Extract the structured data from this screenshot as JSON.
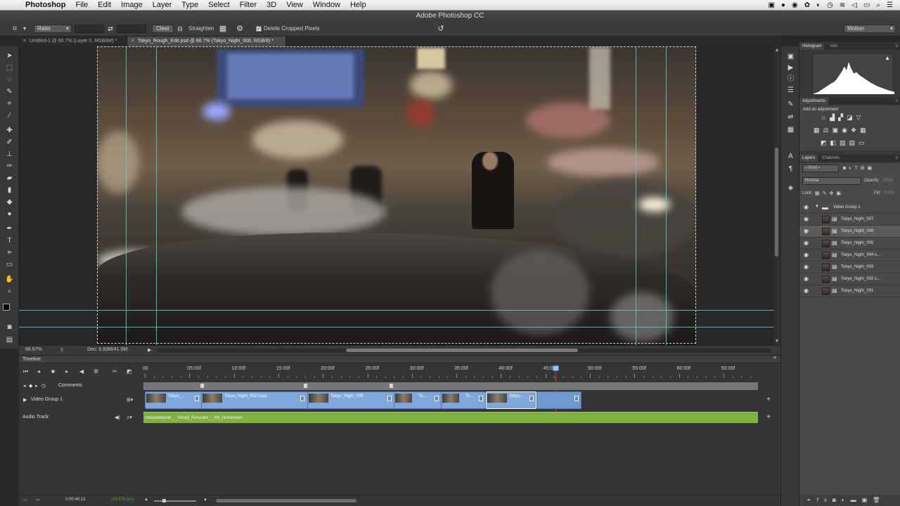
{
  "menubar": {
    "app": "Photoshop",
    "menus": [
      "File",
      "Edit",
      "Image",
      "Layer",
      "Type",
      "Select",
      "Filter",
      "3D",
      "View",
      "Window",
      "Help"
    ]
  },
  "window": {
    "title": "Adobe Photoshop CC"
  },
  "options": {
    "ratio": "Ratio",
    "clear": "Clear",
    "straighten": "Straighten",
    "delete_cropped": "Delete Cropped Pixels",
    "workspace": "Motion"
  },
  "tabs": [
    {
      "label": "Untitled-1 @ 66.7% (Layer 0, RGB/8#) *",
      "active": false
    },
    {
      "label": "Tokyo_Rough_Edit.psd @ 66.7% (Tokyo_Night_006, RGB/8) *",
      "active": true
    }
  ],
  "status": {
    "zoom": "66.67%",
    "doc": "Doc: 5.93M/41.5M"
  },
  "timeline": {
    "title": "Timeline",
    "ruler": [
      "00",
      "05:00f",
      "10:00f",
      "15:00f",
      "20:00f",
      "25:00f",
      "30:00f",
      "35:00f",
      "40:00f",
      "45:00f",
      "50:00f",
      "55:00f",
      "60:00f",
      "65:00f"
    ],
    "comments_label": "Comments",
    "video_group": "Video Group 1",
    "audio_label": "Audio Track",
    "audio_clip": "robwalkerpoet_-_Himeji_Furusato_-_My_Hometown",
    "clips": [
      "Tokyo_...",
      "Tokyo_Night_002 copy",
      "Tokyo_Night_003",
      "To...",
      "To...",
      "Tokyo..."
    ],
    "time": "0:00:46:13",
    "fps": "(23.976 fps)"
  },
  "panels": {
    "histogram_tab": "Histogram",
    "info_tab": "Info",
    "adjustments_tab": "Adjustments",
    "add_adjustment": "Add an adjustment",
    "layers_tab": "Layers",
    "channels_tab": "Channels",
    "kind": "Kind",
    "blend": "Normal",
    "opacity_label": "Opacity:",
    "opacity": "100%",
    "lock_label": "Lock:",
    "fill_label": "Fill:",
    "fill": "100%",
    "group": "Video Group 1",
    "layers": [
      "Tokyo_Night_007",
      "Tokyo_Night_006",
      "Tokyo_Night_005",
      "Tokyo_Night_004 c...",
      "Tokyo_Night_003",
      "Tokyo_Night_002 c...",
      "Tokyo_Night_001"
    ]
  },
  "colors": {
    "guide": "#53d1c1",
    "clip": "#7fa7db",
    "audio": "#80b042",
    "playhead": "#e0332b"
  }
}
